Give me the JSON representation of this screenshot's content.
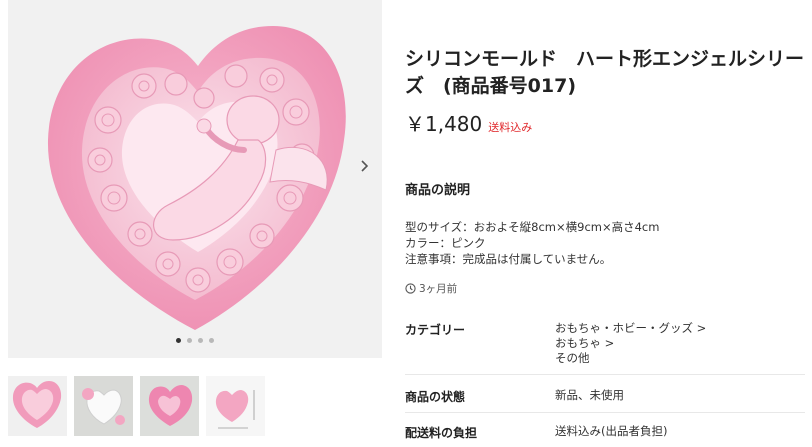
{
  "product": {
    "title": "シリコンモールド　ハート形エンジェルシリーズ　(商品番号017)",
    "price": "￥1,480",
    "shipping_tag": "送料込み"
  },
  "description": {
    "heading": "商品の説明",
    "lines": [
      "型のサイズ：おおよそ縦8cm×横9cm×高さ4cm",
      "カラー：ピンク",
      "注意事項：完成品は付属していません。"
    ],
    "posted": "3ヶ月前"
  },
  "details": {
    "category_label": "カテゴリー",
    "categories": [
      "おもちゃ・ホビー・グッズ >",
      "おもちゃ >",
      "その他"
    ],
    "condition_label": "商品の状態",
    "condition_value": "新品、未使用",
    "shipping_label": "配送料の負担",
    "shipping_value": "送料込み(出品者負担)"
  },
  "gallery": {
    "image_count": 4,
    "active_index": 0,
    "icons": {
      "next": "chevron-right-icon",
      "posted": "clock-icon"
    }
  },
  "colors": {
    "mold_pink": "#f3a6c2",
    "rose_pink": "#f8c4d5",
    "price_tag_red": "#e0272b"
  }
}
